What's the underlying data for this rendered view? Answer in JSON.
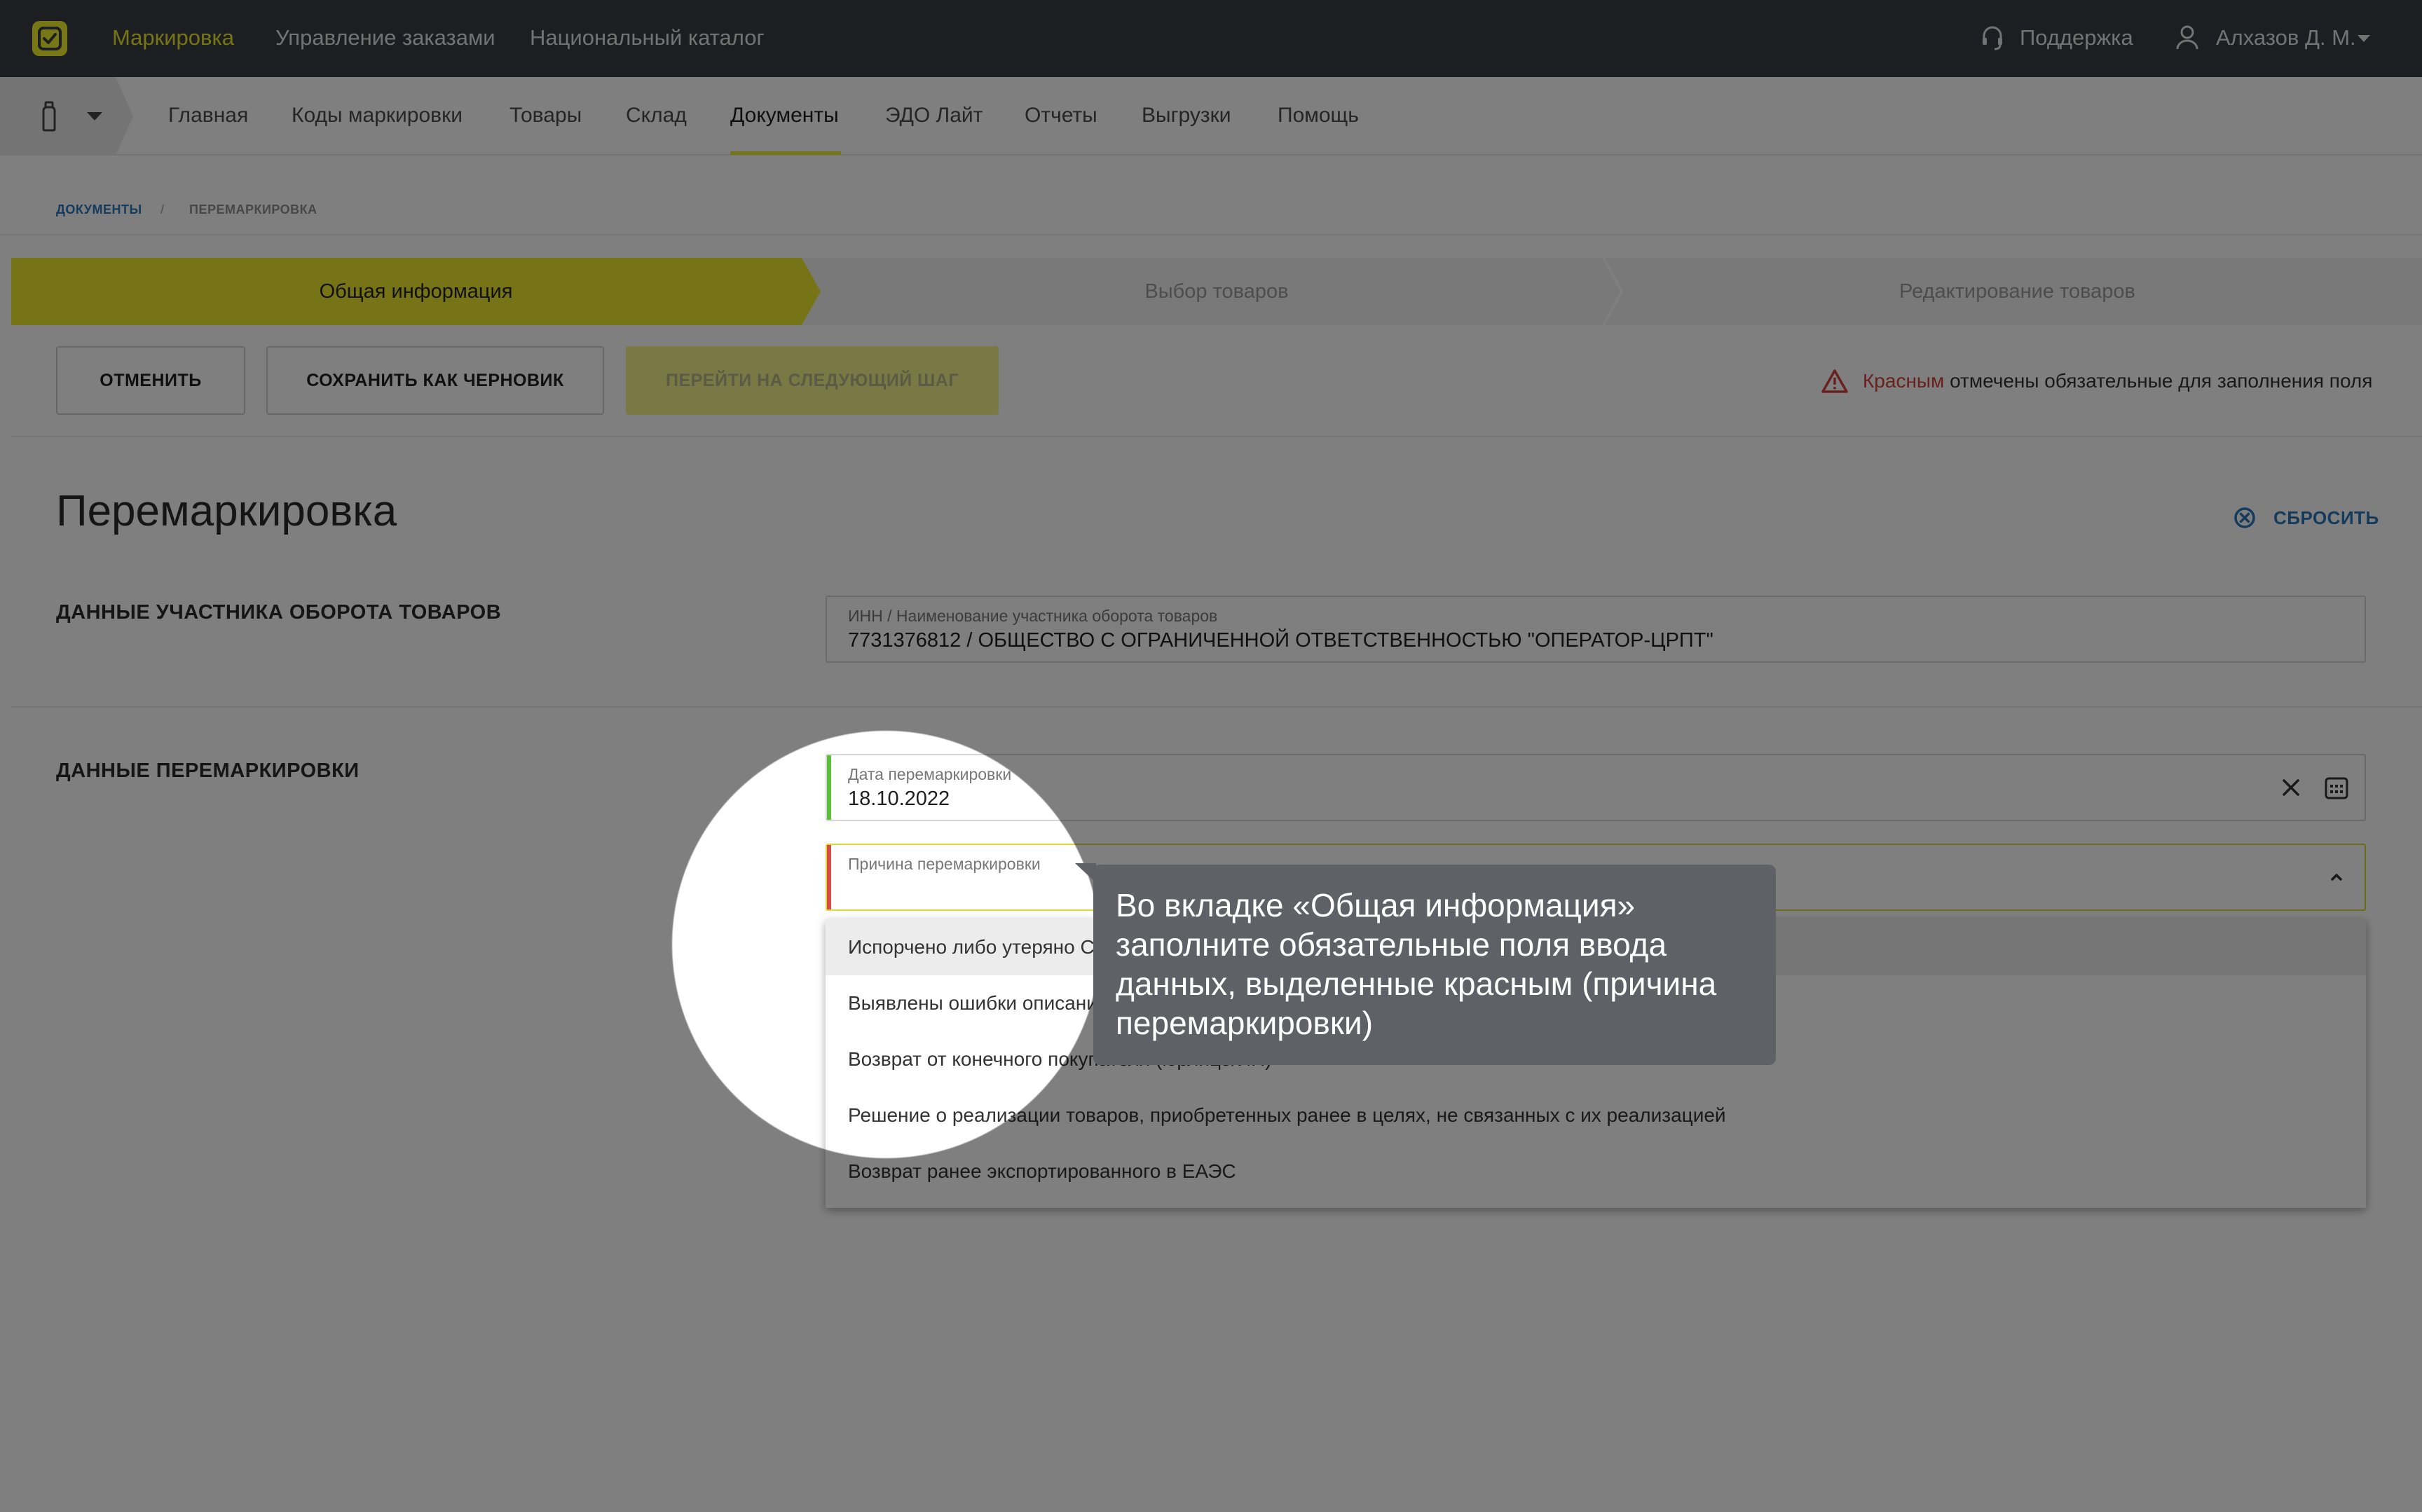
{
  "topbar": {
    "brand_tabs": [
      "Маркировка",
      "Управление заказами",
      "Национальный каталог"
    ],
    "support_label": "Поддержка",
    "user_label": "Алхазов Д. М."
  },
  "subnav": {
    "items": [
      "Главная",
      "Коды маркировки",
      "Товары",
      "Склад",
      "Документы",
      "ЭДО Лайт",
      "Отчеты",
      "Выгрузки",
      "Помощь"
    ],
    "active": "Документы"
  },
  "breadcrumb": {
    "root": "ДОКУМЕНТЫ",
    "separator": "/",
    "current": "ПЕРЕМАРКИРОВКА"
  },
  "steps": [
    "Общая информация",
    "Выбор товаров",
    "Редактирование товаров"
  ],
  "actions": {
    "cancel": "ОТМЕНИТЬ",
    "save_draft": "СОХРАНИТЬ КАК ЧЕРНОВИК",
    "next_step": "ПЕРЕЙТИ НА СЛЕДУЮЩИЙ ШАГ",
    "warning_red": "Красным",
    "warning_rest": " отмечены обязательные для заполнения поля"
  },
  "page": {
    "title": "Перемаркировка",
    "reset_label": "СБРОСИТЬ"
  },
  "participant": {
    "section_title": "ДАННЫЕ УЧАСТНИКА ОБОРОТА ТОВАРОВ",
    "field_label": "ИНН / Наименование участника оборота товаров",
    "field_value": "7731376812 / ОБЩЕСТВО С ОГРАНИЧЕННОЙ ОТВЕТСТВЕННОСТЬЮ \"ОПЕРАТОР-ЦРПТ\""
  },
  "remarking": {
    "section_title": "ДАННЫЕ ПЕРЕМАРКИРОВКИ",
    "date_label": "Дата перемаркировки",
    "date_value": "18.10.2022",
    "reason_label": "Причина перемаркировки",
    "reason_options": [
      "Испорчено либо утеряно СИ",
      "Выявлены ошибки описания товара",
      "Возврат от конечного покупателя (юрлицо/ИП)",
      "Решение о реализации товаров, приобретенных ранее в целях, не связанных с их реализацией",
      "Возврат ранее экспортированного в ЕАЭС"
    ]
  },
  "tooltip": {
    "text": "Во вкладке «Общая информация» заполните обязательные поля ввода данных, выделенные красным (причина перемаркировки)"
  },
  "colors": {
    "accent_yellow": "#ECE92F",
    "link_blue": "#2A76B8",
    "required_red": "#D64B45",
    "valid_green": "#5CBF3A",
    "topbar": "#3A3D43"
  },
  "icons": [
    "logo-icon",
    "headset-icon",
    "user-icon",
    "bottle-icon",
    "warning-icon",
    "reset-icon",
    "close-icon",
    "calendar-icon",
    "chevron-up-icon"
  ]
}
